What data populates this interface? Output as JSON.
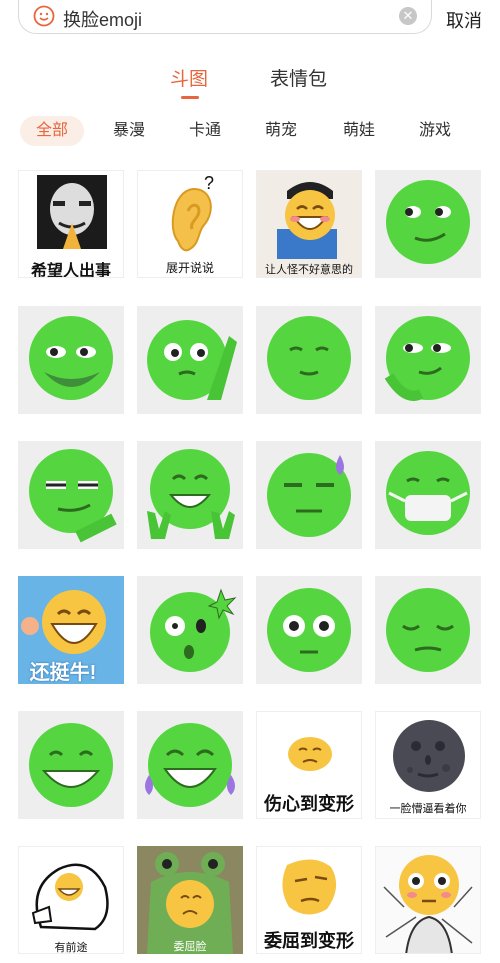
{
  "search": {
    "value": "换脸emoji",
    "cancel_label": "取消"
  },
  "tabs": [
    {
      "label": "斗图"
    },
    {
      "label": "表情包"
    }
  ],
  "categories": [
    {
      "label": "全部"
    },
    {
      "label": "暴漫"
    },
    {
      "label": "卡通"
    },
    {
      "label": "萌宠"
    },
    {
      "label": "萌娃"
    },
    {
      "label": "游戏"
    }
  ],
  "grid": {
    "captions": {
      "r1c1": "希望人出事",
      "r1c2": "展开说说",
      "r1c3": "让人怪不好意思的",
      "r4c1": "还挺牛!",
      "r5c3": "伤心到变形",
      "r5c4": "一脸懵逼看着你",
      "r6c1": "有前途",
      "r6c2": "委屈脸",
      "r6c3": "委屈到变形"
    },
    "question_mark": "?"
  },
  "colors": {
    "accent": "#e8663d",
    "green": "#55d640",
    "gray_bg": "#eeeeee"
  }
}
